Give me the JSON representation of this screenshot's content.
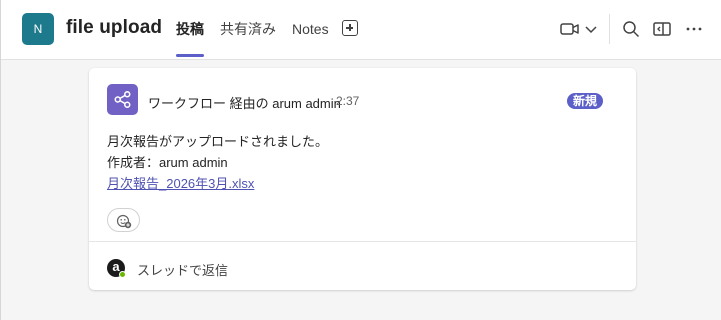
{
  "channel": {
    "avatar_letter": "N",
    "avatar_color": "#1d7a8c",
    "title": "file upload"
  },
  "tabs": [
    {
      "label": "投稿",
      "active": true
    },
    {
      "label": "共有済み",
      "active": false
    },
    {
      "label": "Notes",
      "active": false
    }
  ],
  "header_actions": {
    "add_tab_icon": "plus-square-icon",
    "meet_icon": "video-camera-icon",
    "meet_dropdown_icon": "chevron-down-icon",
    "search_icon": "search-icon",
    "panel_icon": "side-panel-icon",
    "more_icon": "more-horizontal-icon"
  },
  "message": {
    "app_icon": "workflow-share-icon",
    "app_icon_color": "#7161c4",
    "sender": "ワークフロー 経由の arum admin",
    "time": "2:37",
    "badge": "新規",
    "badge_color": "#5b5fc7",
    "lines": [
      "月次報告がアップロードされました。",
      "作成者：arum admin"
    ],
    "link": "月次報告_2026年3月.xlsx",
    "link_color": "#4f52b2",
    "reaction_icon": "emoji-add-icon"
  },
  "reply": {
    "avatar_letter": "a",
    "presence": "available",
    "label": "スレッドで返信"
  }
}
